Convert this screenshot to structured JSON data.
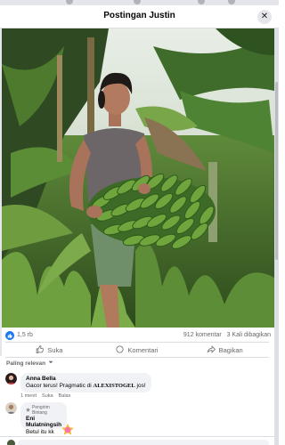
{
  "post": {
    "title": "Postingan Justin"
  },
  "stats": {
    "likes": "1,5 rb",
    "comments": "912 komentar",
    "shares": "3 Kali dibagikan"
  },
  "actions": {
    "like": "Suka",
    "comment": "Komentari",
    "share": "Bagikan"
  },
  "comments_section": {
    "sort_label": "Paling relevan"
  },
  "comments": [
    {
      "author": "Anna Bella",
      "text_before": "Gacor terus! Pragmatic di ",
      "text_brand": "ALEXISTOGEL",
      "text_after": " jos!",
      "time": "1 menit",
      "like": "Suka",
      "reply": "Balas"
    },
    {
      "badge": "Pengirim Bintang",
      "author": "Eni Mulatningsih",
      "text": "Betul itu kk"
    }
  ],
  "colors": {
    "accent": "#1877f2",
    "bubble": "#f0f2f5",
    "muted_text": "#65676b"
  }
}
